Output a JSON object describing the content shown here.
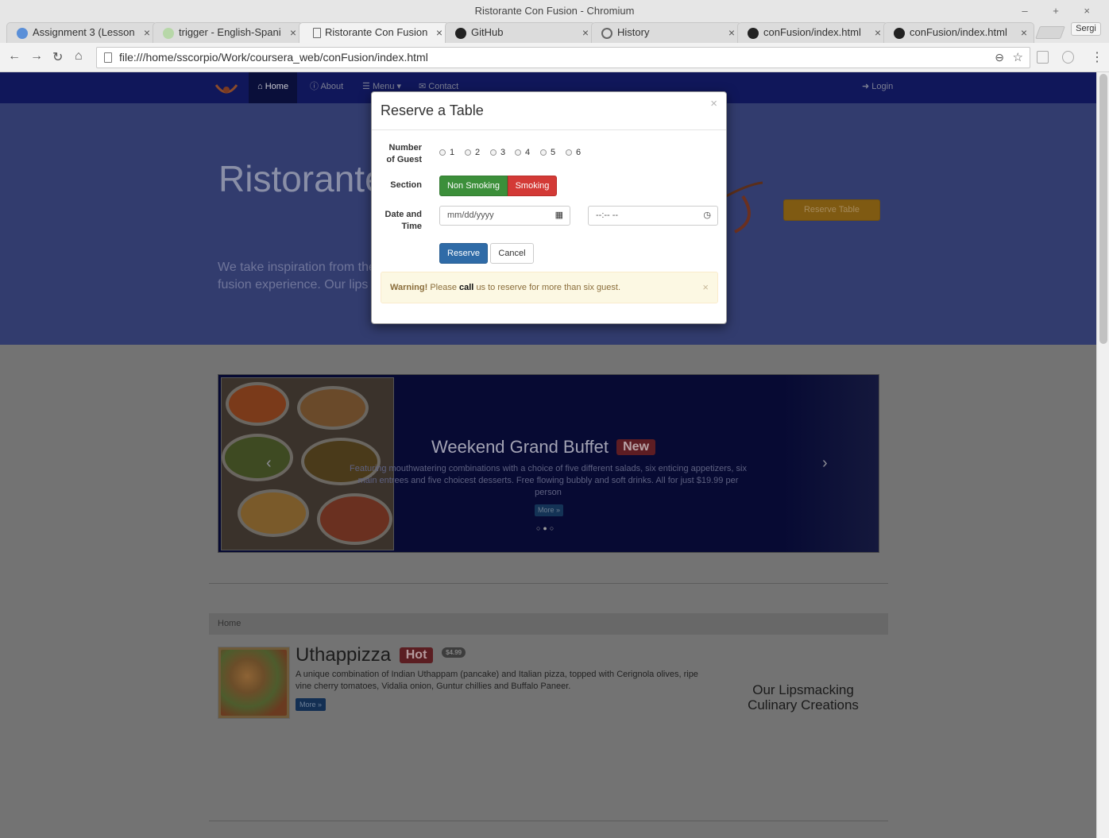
{
  "window": {
    "title": "Ristorante Con Fusion - Chromium",
    "controls": "– + ×"
  },
  "tabs": [
    {
      "label": "Assignment 3 (Lesson",
      "icon": "coursera-icon"
    },
    {
      "label": "trigger - English-Spani",
      "icon": "wordreference-icon"
    },
    {
      "label": "Ristorante Con Fusion",
      "icon": "page-icon"
    },
    {
      "label": "GitHub",
      "icon": "github-icon"
    },
    {
      "label": "History",
      "icon": "history-icon"
    },
    {
      "label": "conFusion/index.html",
      "icon": "github-icon"
    },
    {
      "label": "conFusion/index.html",
      "icon": "github-icon"
    }
  ],
  "tab_close": "×",
  "user_button": "Sergi",
  "toolbar": {
    "back": "←",
    "forward": "→",
    "reload": "↻",
    "home": "⌂",
    "url": "file:///home/sscorpio/Work/coursera_web/conFusion/index.html",
    "zoom_icon": "⊖",
    "star_icon": "☆",
    "menu": "⋮"
  },
  "navbar": {
    "items": [
      {
        "label": "Home",
        "icon": "home-icon",
        "glyph": "⌂"
      },
      {
        "label": "About",
        "icon": "info-icon",
        "glyph": "ⓘ"
      },
      {
        "label": "Menu",
        "icon": "list-icon",
        "glyph": "☰",
        "caret": "▾"
      },
      {
        "label": "Contact",
        "icon": "envelope-icon",
        "glyph": "✉"
      }
    ],
    "login": {
      "label": "Login",
      "glyph": "➜"
    }
  },
  "jumbotron": {
    "title": "Ristorante",
    "text": "We take inspiration from the fusion experience. Our lips",
    "reserve_button": "Reserve Table"
  },
  "carousel": {
    "title": "Weekend Grand Buffet",
    "badge": "New",
    "text": "Featuring mouthwatering combinations with a choice of five different salads, six enticing appetizers, six main entrees and five choicest desserts. Free flowing bubbly and soft drinks. All for just $19.99 per person",
    "more": "More »",
    "prev": "‹",
    "next": "›",
    "indicators": "○●○"
  },
  "breadcrumb": "Home",
  "dish": {
    "name": "Uthappizza",
    "badge": "Hot",
    "price": "$4.99",
    "description": "A unique combination of Indian Uthappam (pancake) and Italian pizza, topped with Cerignola olives, ripe vine cherry tomatoes, Vidalia onion, Guntur chillies and Buffalo Paneer.",
    "more": "More »"
  },
  "side_heading": "Our Lipsmacking Culinary Creations",
  "modal": {
    "title": "Reserve a Table",
    "close": "×",
    "guest_label": "Number of Guest",
    "guest_options": [
      "1",
      "2",
      "3",
      "4",
      "5",
      "6"
    ],
    "section_label": "Section",
    "section_non_smoking": "Non Smoking",
    "section_smoking": "Smoking",
    "datetime_label": "Date and Time",
    "date_placeholder": "mm/dd/yyyy",
    "time_placeholder": "--:-- --",
    "calendar_glyph": "▦",
    "clock_glyph": "◷",
    "reserve": "Reserve",
    "cancel": "Cancel",
    "alert": {
      "strong": "Warning!",
      "pre": "Please",
      "call": "call",
      "post": "us to reserve for more than six guest.",
      "close": "×"
    }
  }
}
